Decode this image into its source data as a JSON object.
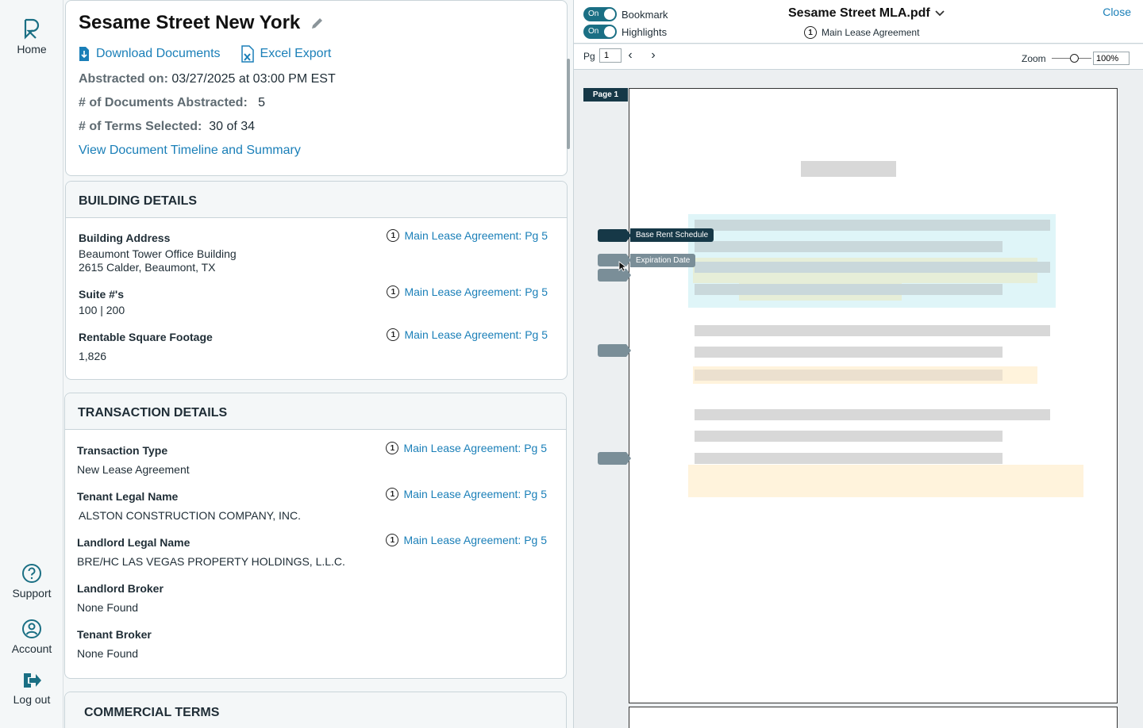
{
  "nav": {
    "home": "Home",
    "support": "Support",
    "account": "Account",
    "logout": "Log out"
  },
  "header": {
    "title": "Sesame Street New York",
    "download": "Download Documents",
    "excel": "Excel Export",
    "abstracted_on_label": "Abstracted on:",
    "abstracted_on_value": "03/27/2025 at 03:00 PM EST",
    "docs_label": "# of Documents Abstracted:",
    "docs_value": "5",
    "terms_label": "# of Terms Selected:",
    "terms_value": "30 of 34",
    "timeline_link": "View Document Timeline and Summary"
  },
  "building": {
    "heading": "BUILDING DETAILS",
    "fields": [
      {
        "label": "Building Address",
        "value1": "Beaumont Tower Office Building",
        "value2": "2615 Calder, Beaumont, TX",
        "ref_num": "1",
        "ref": "Main Lease Agreement: Pg 5"
      },
      {
        "label": "Suite #'s",
        "value1": "100 | 200",
        "ref_num": "1",
        "ref": "Main Lease Agreement: Pg 5"
      },
      {
        "label": "Rentable Square Footage",
        "value1": "1,826",
        "ref_num": "1",
        "ref": "Main Lease Agreement: Pg 5"
      }
    ]
  },
  "transaction": {
    "heading": "TRANSACTION DETAILS",
    "fields": [
      {
        "label": "Transaction Type",
        "value": "New Lease Agreement",
        "ref_num": "1",
        "ref": "Main Lease Agreement: Pg 5"
      },
      {
        "label": "Tenant Legal Name",
        "value": "ALSTON CONSTRUCTION COMPANY, INC.",
        "ref_num": "1",
        "ref": "Main Lease Agreement: Pg 5"
      },
      {
        "label": "Landlord Legal Name",
        "value": "BRE/HC LAS VEGAS PROPERTY HOLDINGS, L.L.C.",
        "ref_num": "1",
        "ref": "Main Lease Agreement: Pg 5"
      },
      {
        "label": "Landlord Broker",
        "value": "None Found"
      },
      {
        "label": "Tenant Broker",
        "value": "None Found"
      }
    ]
  },
  "commercial": {
    "heading": "COMMERCIAL TERMS"
  },
  "viewer": {
    "bookmark_toggle_state": "On",
    "bookmark_label": "Bookmark",
    "highlights_toggle_state": "On",
    "highlights_label": "Highlights",
    "file_name": "Sesame Street MLA.pdf",
    "doc_num": "1",
    "doc_name": "Main Lease Agreement",
    "close": "Close",
    "pg_label": "Pg",
    "pg_value": "1",
    "zoom_label": "Zoom",
    "zoom_value": "100%",
    "zoom_level": 0.5,
    "page_tag": "Page 1",
    "bookmark_1": "Base Rent Schedule",
    "bookmark_2": "Expiration Date"
  },
  "colors": {
    "link": "#1a7fb8",
    "accent": "#1a6f84",
    "dark": "#163847",
    "highlight_blue": "#dff5f8",
    "highlight_yellow": "#fff3dc"
  }
}
